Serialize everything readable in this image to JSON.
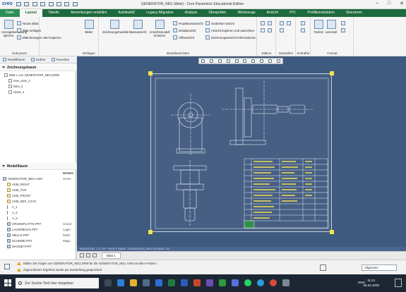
{
  "app": {
    "logo": "creo",
    "window_title": "GENERATOR_NEU (Aktiv) - Creo Parametric Educational Edition"
  },
  "window_controls": {
    "minimize": "–",
    "maximize": "□",
    "close": "✕"
  },
  "ribbon_tabs": [
    {
      "label": "Datei"
    },
    {
      "label": "Layout"
    },
    {
      "label": "Tabelle"
    },
    {
      "label": "Anmerkungen erstellen"
    },
    {
      "label": "AutobuildZ"
    },
    {
      "label": "Legacy-Migration"
    },
    {
      "label": "Analyse"
    },
    {
      "label": "Überprüfen"
    },
    {
      "label": "Werkzeuge"
    },
    {
      "label": "Ansicht"
    },
    {
      "label": "HTL"
    },
    {
      "label": "Profilkonstruktion"
    },
    {
      "label": "Skizzieren"
    }
  ],
  "ribbon": {
    "dokument": {
      "label": "Dokument",
      "anzeige": "Anzeigebemaßung\nsperren",
      "neues_blatt": "Neues Blatt",
      "blatt_einfuegen": "Blatt einfügen",
      "blatt_bewegen": "Blatt bewegen oder kopieren"
    },
    "einfuegen": {
      "label": "Einfügen",
      "bilder": "Bilder"
    },
    "modellansichten": {
      "label": "Modellansichten",
      "zeichnungsmodelle": "Zeichnungsmodelle",
      "basisansicht": "Basisansicht",
      "ansichtsmodell": "Ansichtsmodell\nersetzen",
      "projektionsansicht": "Projektionsansicht",
      "detailansicht": "Detailansicht",
      "hilfsansicht": "Hilfsansicht",
      "gedrehte": "Gedrehte Ansicht",
      "kopieren": "Ansicht kopieren und ausrichten",
      "zeichnung": "Zeichnungsansicht-Informationen"
    },
    "edition": {
      "label": "Edition"
    },
    "darstellen": {
      "label": "Darstellen"
    },
    "schraffur": {
      "label": "Schraffur"
    },
    "format": {
      "label": "Format",
      "textstil": "Textstil",
      "linienstil": "Linienstil"
    }
  },
  "navigator": {
    "tabs": [
      "Modellbaum",
      "Ordner",
      "Favoriten"
    ],
    "drawing_tree": {
      "title": "Zeichnungsbaum",
      "items": [
        "Blatt 1 von GENERATOR_NEU.DRW",
        "new_view_2",
        "links_3",
        "views_4"
      ]
    },
    "model_tree": {
      "title": "Modellbaum",
      "column": "BENEN",
      "items": [
        {
          "label": "GENERATOR_NEU.ASM",
          "value": "Gener",
          "icon": "part"
        },
        {
          "label": "ASM_RIGHT",
          "value": "",
          "icon": "plane"
        },
        {
          "label": "ASM_TOP",
          "value": "",
          "icon": "plane"
        },
        {
          "label": "ASM_FRONT",
          "value": "",
          "icon": "plane"
        },
        {
          "label": "ASM_DEF_CSYS",
          "value": "",
          "icon": "plane"
        },
        {
          "label": "A_1",
          "value": "",
          "icon": "axis"
        },
        {
          "label": "A_2",
          "value": "",
          "icon": "axis"
        },
        {
          "label": "A_3",
          "value": "",
          "icon": "axis"
        },
        {
          "label": "GRUNDPLATTE.PRT",
          "value": "Grund",
          "icon": "part"
        },
        {
          "label": "LAGERBOCK.PRT",
          "value": "Lager",
          "icon": "part"
        },
        {
          "label": "WELLE.PRT",
          "value": "Welle",
          "icon": "part"
        },
        {
          "label": "SCHEIBE.PRT",
          "value": "Magn",
          "icon": "part"
        },
        {
          "label": "MAGNET.PRT",
          "value": "",
          "icon": "part"
        }
      ]
    }
  },
  "canvas": {
    "status_line": "MASSSTAB : 1:2   TYP : HAUPT   NAME : GENERATOR_NEU   GRÖSSE : A3",
    "sheet_tab": "Blatt 1"
  },
  "messages": [
    "Bilden Sie Folgen von GENERATOR_NEU.DRW für die GENERATOR_NEU.ASM mit allen Feldern.",
    "Zugeordnetes Ergebnis wurde per Darstellung gespeichert."
  ],
  "selection_filter": "Allgemein",
  "taskbar": {
    "search_placeholder": "Zur Suche Text hier eingeben",
    "time": "11:21",
    "date": "25.02.2020",
    "tray_text": "ENG"
  },
  "colors": {
    "tab_bar": "#1d6a3d",
    "canvas": "#3e5a7e",
    "corner_marks": "#f5e24b"
  }
}
